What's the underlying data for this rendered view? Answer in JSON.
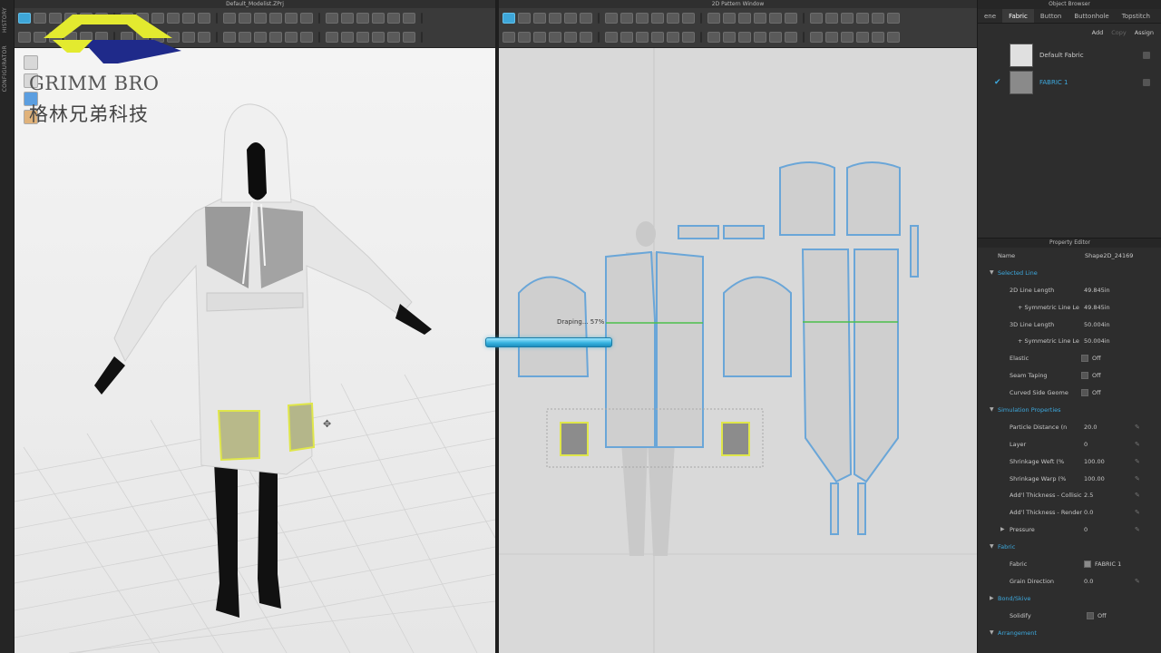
{
  "vstrip": {
    "history": "HISTORY",
    "configurator": "CONFIGURATOR"
  },
  "win3d": {
    "title": "Default_Modelist.ZPrj"
  },
  "logo": {
    "english": "GRIMM BRO",
    "chinese": "格林兄弟科技",
    "accent_yellow": "#e3ea2f",
    "accent_navy": "#1f2a8a"
  },
  "win2d": {
    "title": "2D Pattern Window",
    "draping_text": "Draping... 57%",
    "draping_progress": 0.57
  },
  "object_browser": {
    "title": "Object Browser",
    "tabs": [
      "ene",
      "Fabric",
      "Button",
      "Buttonhole",
      "Topstitch"
    ],
    "actions": {
      "add": "Add",
      "copy": "Copy",
      "assign": "Assign"
    },
    "fabrics": [
      {
        "name": "Default Fabric",
        "color": "#e0e0e0",
        "selected": false
      },
      {
        "name": "FABRIC 1",
        "color": "#8a8a8a",
        "selected": true
      }
    ]
  },
  "property_editor": {
    "title": "Property Editor",
    "name_label": "Name",
    "name_value": "Shape2D_24169",
    "rows": [
      {
        "type": "section",
        "label": "Selected Line"
      },
      {
        "type": "kv",
        "label": "2D Line Length",
        "value": "49.845in"
      },
      {
        "type": "kv",
        "label": "+ Symmetric Line Le",
        "value": "49.845in",
        "sub": true
      },
      {
        "type": "kv",
        "label": "3D Line Length",
        "value": "50.004in"
      },
      {
        "type": "kv",
        "label": "+ Symmetric Line Le",
        "value": "50.004in",
        "sub": true
      },
      {
        "type": "cb",
        "label": "Elastic",
        "value": "Off"
      },
      {
        "type": "cb",
        "label": "Seam Taping",
        "value": "Off"
      },
      {
        "type": "cb",
        "label": "Curved Side Geome",
        "value": "Off"
      },
      {
        "type": "section",
        "label": "Simulation Properties"
      },
      {
        "type": "kv",
        "label": "Particle Distance (n",
        "value": "20.0",
        "pen": true
      },
      {
        "type": "kv",
        "label": "Layer",
        "value": "0",
        "pen": true
      },
      {
        "type": "kv",
        "label": "Shrinkage Weft (%",
        "value": "100.00",
        "pen": true
      },
      {
        "type": "kv",
        "label": "Shrinkage Warp (%",
        "value": "100.00",
        "pen": true
      },
      {
        "type": "kv",
        "label": "Add'l Thickness - Collisic",
        "value": "2.5",
        "pen": true
      },
      {
        "type": "kv",
        "label": "Add'l Thickness - Render",
        "value": "0.0",
        "pen": true
      },
      {
        "type": "kv",
        "label": "Pressure",
        "value": "0",
        "sub": false,
        "pressure": true,
        "pen": true
      },
      {
        "type": "section",
        "label": "Fabric"
      },
      {
        "type": "fabric",
        "label": "Fabric",
        "value": "FABRIC 1"
      },
      {
        "type": "kv",
        "label": "Grain Direction",
        "value": "0.0",
        "pen": true
      },
      {
        "type": "section",
        "label": "Bond/Skive",
        "collapsed": true
      },
      {
        "type": "cbtop",
        "label": "Solidify",
        "value": "Off"
      },
      {
        "type": "section",
        "label": "Arrangement"
      }
    ]
  }
}
